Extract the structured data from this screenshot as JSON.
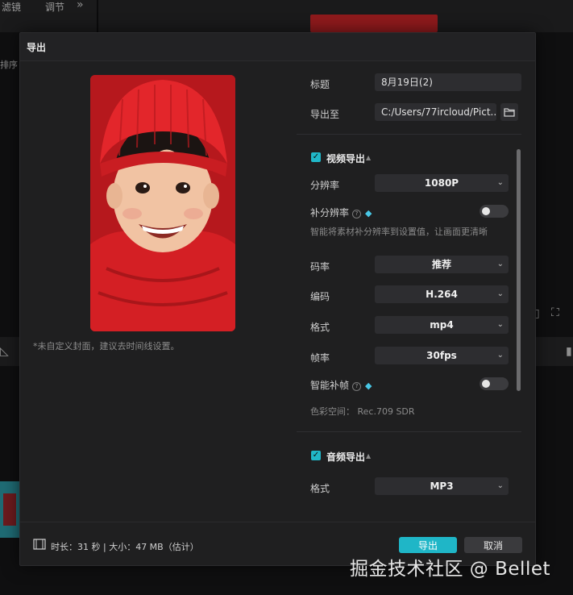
{
  "background": {
    "tab_filter": "滤镜",
    "tab_adjust": "调节",
    "left_text": "排序"
  },
  "dialog": {
    "title": "导出",
    "cover_note": "*未自定义封面，建议去时间线设置。",
    "title_label": "标题",
    "title_value": "8月19日(2)",
    "export_to_label": "导出至",
    "export_path": "C:/Users/77ircloud/Pict...",
    "video": {
      "section_title": "视频导出",
      "resolution_label": "分辨率",
      "resolution_value": "1080P",
      "super_res_label": "补分辨率",
      "super_res_hint": "智能将素材补分辨率到设置值，让画面更清晰",
      "bitrate_label": "码率",
      "bitrate_value": "推荐",
      "codec_label": "编码",
      "codec_value": "H.264",
      "format_label": "格式",
      "format_value": "mp4",
      "framerate_label": "帧率",
      "framerate_value": "30fps",
      "smart_frame_label": "智能补帧",
      "color_space": "色彩空间：  Rec.709 SDR"
    },
    "audio": {
      "section_title": "音频导出",
      "format_label": "格式",
      "format_value": "MP3"
    },
    "footer": {
      "info": "时长：31 秒 | 大小：47 MB（估计）",
      "export_button": "导出",
      "cancel_button": "取消"
    }
  },
  "watermark": "掘金技术社区 @ Bellet",
  "colors": {
    "accent": "#1fb6c7",
    "dialog_bg": "#1f1f20",
    "field_bg": "#2d2d30"
  }
}
